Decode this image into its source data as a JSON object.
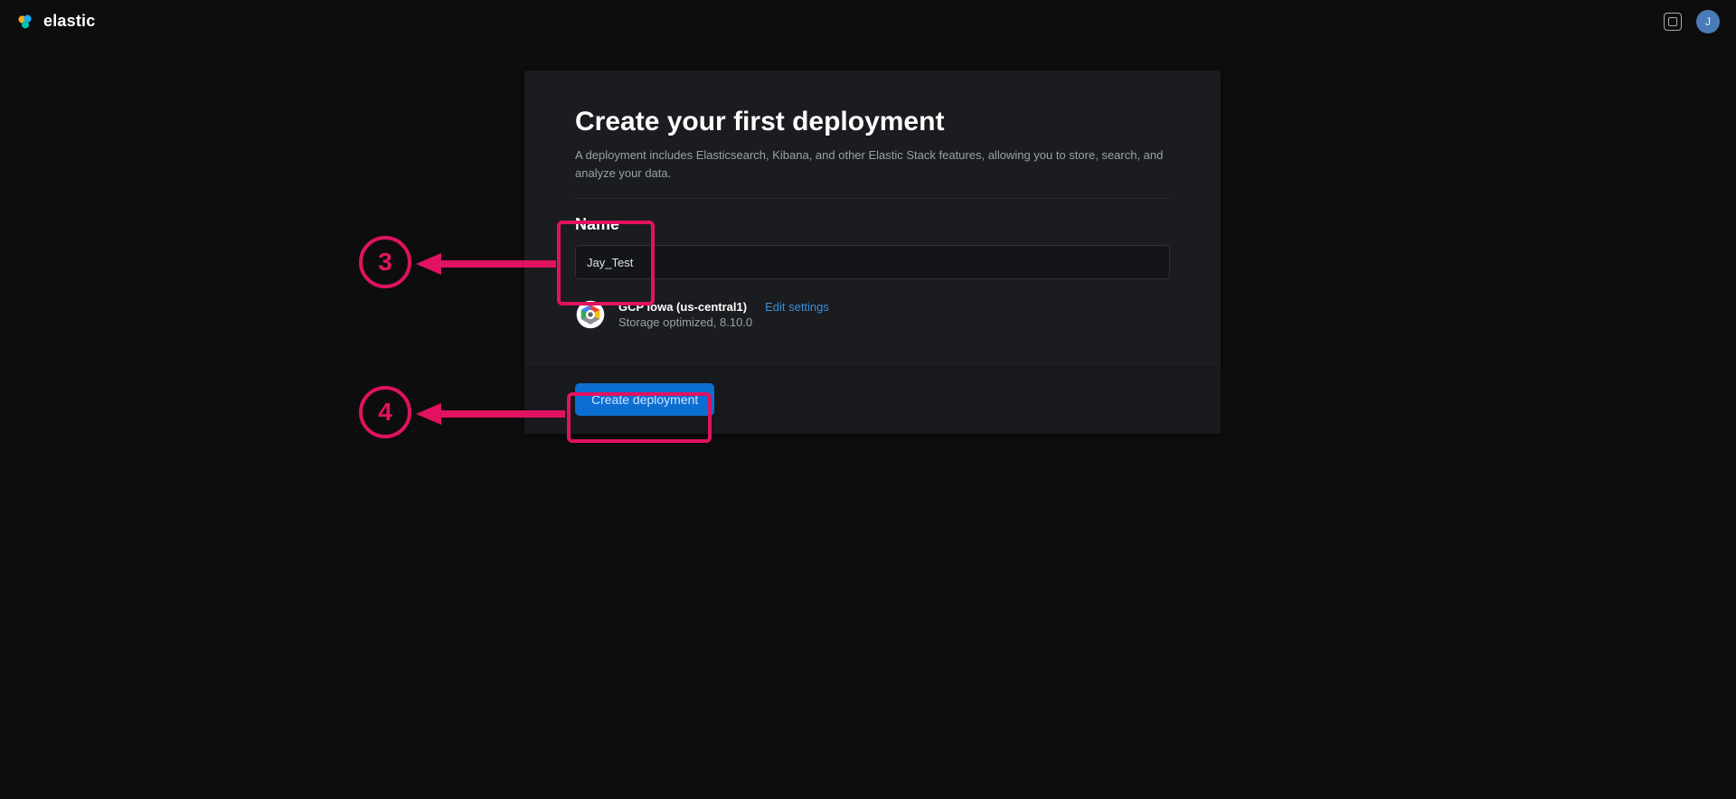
{
  "header": {
    "brand": "elastic",
    "avatar_initial": "J"
  },
  "panel": {
    "title": "Create your first deployment",
    "subtitle": "A deployment includes Elasticsearch, Kibana, and other Elastic Stack features, allowing you to store, search, and analyze your data.",
    "name_label": "Name",
    "name_value": "Jay_Test",
    "provider_region": "GCP Iowa (us-central1)",
    "provider_config": "Storage optimized, 8.10.0",
    "edit_link": "Edit settings",
    "create_button": "Create deployment"
  },
  "annotations": {
    "step3": "3",
    "step4": "4"
  }
}
